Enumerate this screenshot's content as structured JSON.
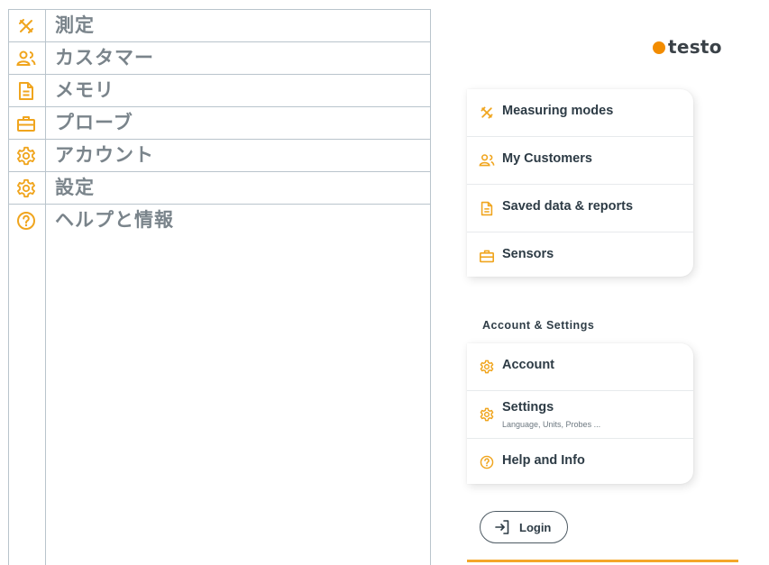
{
  "jp_menu": {
    "items": [
      {
        "label": "測定",
        "icon": "measuring-tools-icon"
      },
      {
        "label": "カスタマー",
        "icon": "customers-icon"
      },
      {
        "label": "メモリ",
        "icon": "document-icon"
      },
      {
        "label": "プローブ",
        "icon": "sensor-case-icon"
      },
      {
        "label": "アカウント",
        "icon": "gear-icon"
      },
      {
        "label": "設定",
        "icon": "gear-icon"
      },
      {
        "label": "ヘルプと情報",
        "icon": "help-icon"
      }
    ]
  },
  "brand": {
    "name": "testo",
    "dot_color": "#f28c00"
  },
  "main_menu": {
    "items": [
      {
        "label": "Measuring modes",
        "icon": "measuring-tools-icon"
      },
      {
        "label": "My Customers",
        "icon": "customers-icon"
      },
      {
        "label": "Saved data & reports",
        "icon": "document-icon"
      },
      {
        "label": "Sensors",
        "icon": "sensor-case-icon"
      }
    ]
  },
  "account_section": {
    "title": "Account & Settings",
    "items": [
      {
        "label": "Account",
        "sub": "",
        "icon": "gear-icon"
      },
      {
        "label": "Settings",
        "sub": "Language, Units, Probes ...",
        "icon": "gear-icon"
      },
      {
        "label": "Help and Info",
        "sub": "",
        "icon": "help-icon"
      }
    ]
  },
  "login": {
    "label": "Login",
    "icon": "login-arrow-icon"
  },
  "colors": {
    "accent": "#f4a72a",
    "icon": "#f0a51e",
    "text": "#2d3b45",
    "table_text": "#7a848b",
    "table_border": "#b9c4cc"
  }
}
